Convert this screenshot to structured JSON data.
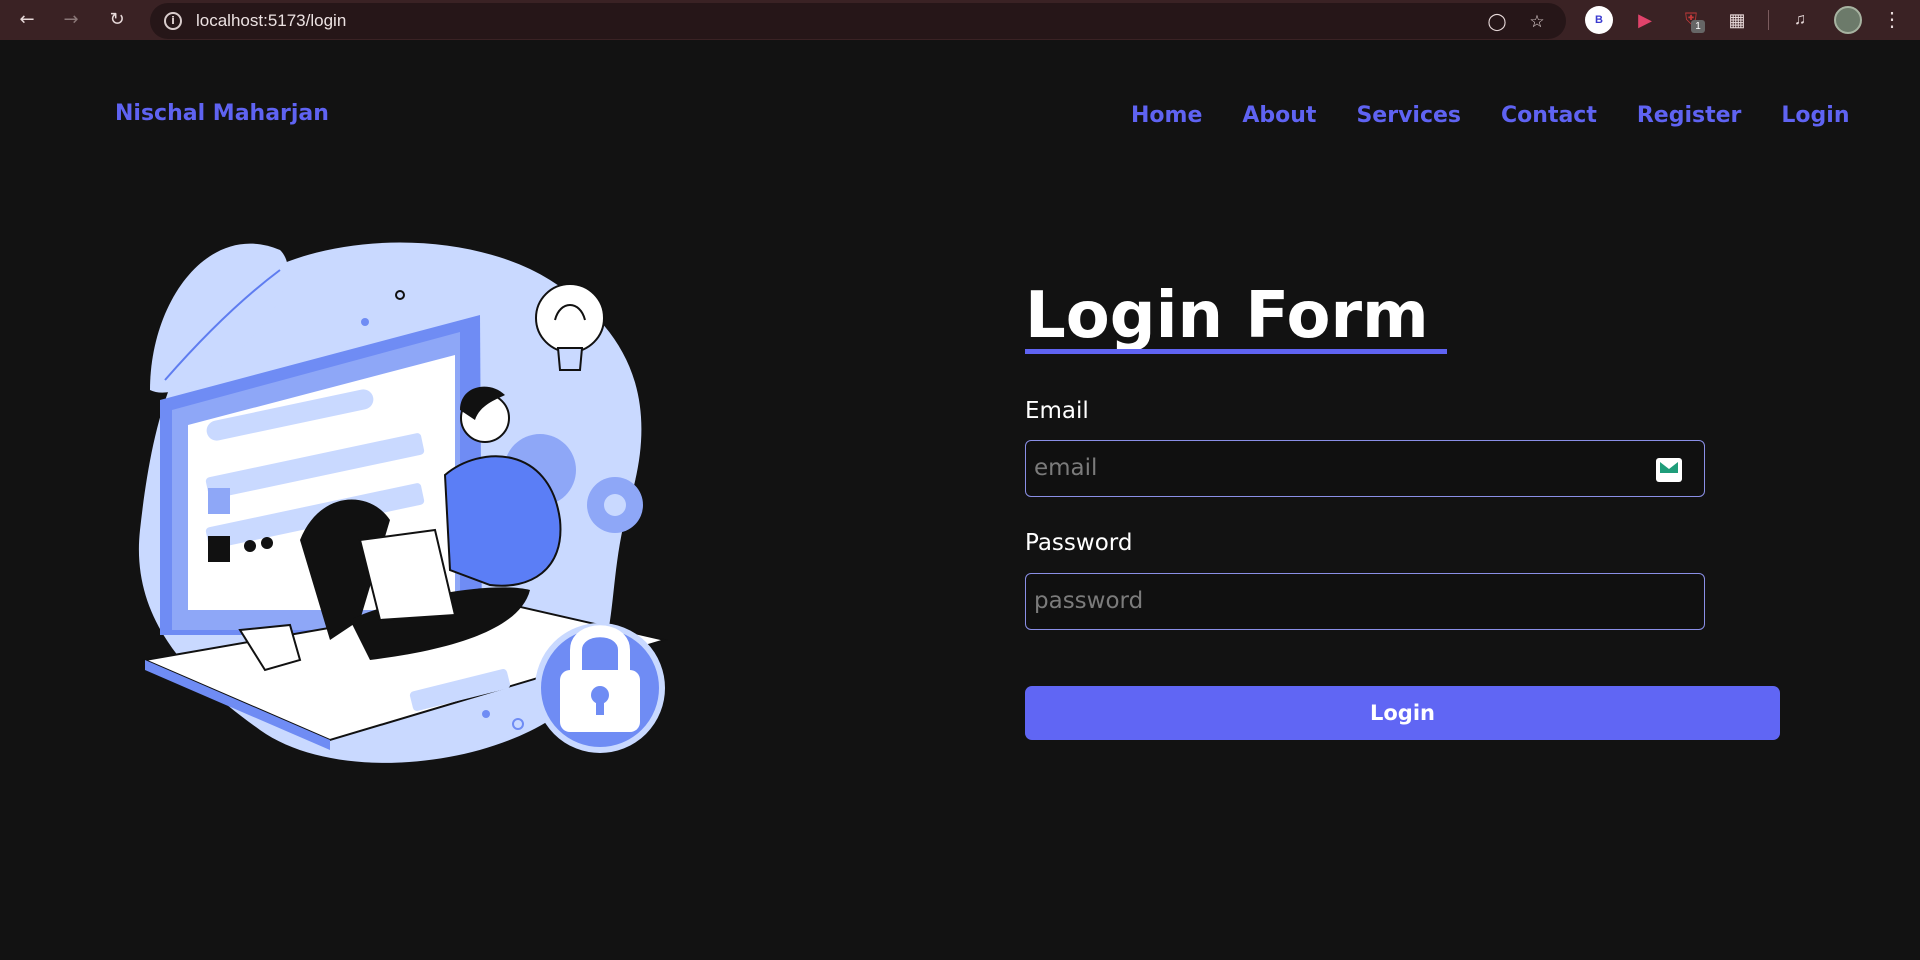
{
  "browser": {
    "url": "localhost:5173/login",
    "extension_b_label": "B",
    "extension_badge_count": "1"
  },
  "brand": {
    "name": "Nischal Maharjan",
    "color": "#5f63f2"
  },
  "nav": {
    "items": [
      {
        "label": "Home"
      },
      {
        "label": "About"
      },
      {
        "label": "Services"
      },
      {
        "label": "Contact"
      },
      {
        "label": "Register"
      },
      {
        "label": "Login"
      }
    ]
  },
  "form": {
    "title": "Login Form",
    "email_label": "Email",
    "email_placeholder": "email",
    "password_label": "Password",
    "password_placeholder": "password",
    "submit_label": "Login",
    "accent": "#6066f4"
  },
  "icons": {
    "back": "arrow-left-icon",
    "forward": "arrow-right-icon",
    "reload": "reload-icon",
    "info": "info-icon",
    "eye_off": "eye-off-icon",
    "bookmark": "star-icon",
    "mail": "mail-icon",
    "lock": "padlock-icon"
  }
}
